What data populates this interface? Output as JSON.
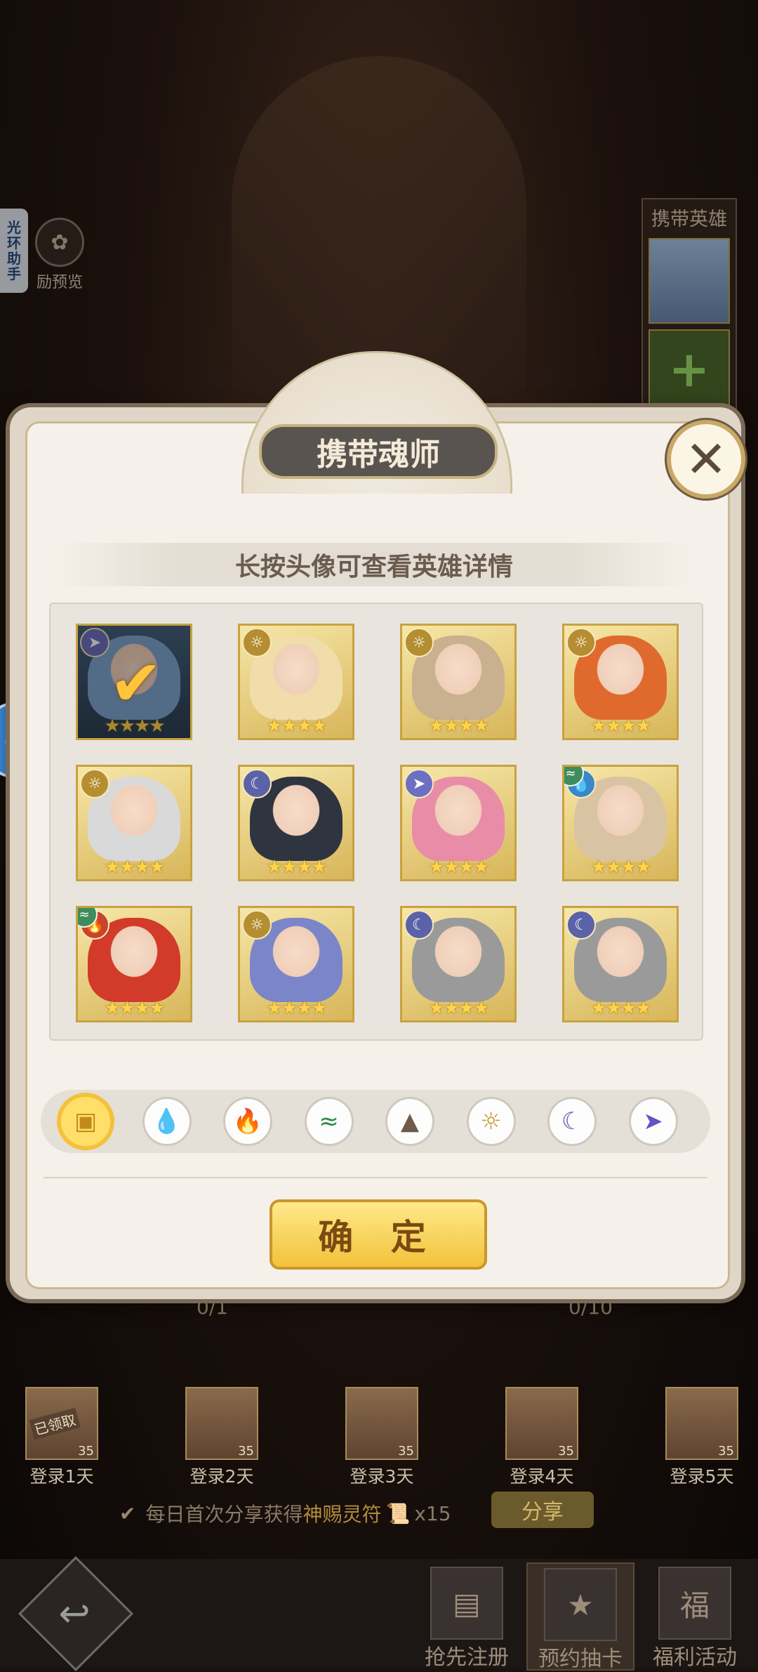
{
  "side": {
    "assist_tab": [
      "光",
      "环",
      "助",
      "手"
    ],
    "reward_preview": "励预览"
  },
  "carry_hero_panel": {
    "title": "携带英雄",
    "add_icon": "plus-icon"
  },
  "modal": {
    "title": "携带魂师",
    "hint": "长按头像可查看英雄详情",
    "confirm": "确 定",
    "close_icon": "close-icon"
  },
  "heroes": [
    {
      "element": "arrow",
      "stars": 4,
      "selected": true,
      "face": "#7fa6cf"
    },
    {
      "element": "sun",
      "stars": 4,
      "selected": false,
      "face": "#f1ddaa"
    },
    {
      "element": "sun",
      "stars": 4,
      "selected": false,
      "face": "#c9b08e"
    },
    {
      "element": "sun",
      "stars": 4,
      "selected": false,
      "face": "#e06a2e"
    },
    {
      "element": "sun",
      "stars": 4,
      "selected": false,
      "face": "#d9d9d9"
    },
    {
      "element": "moon",
      "stars": 4,
      "selected": false,
      "face": "#2e3440"
    },
    {
      "element": "arrow",
      "stars": 4,
      "selected": false,
      "face": "#e98ca7"
    },
    {
      "element": "water",
      "sub_element": "wind",
      "stars": 4,
      "selected": false,
      "face": "#d8c4a2"
    },
    {
      "element": "fire",
      "sub_element": "wind",
      "stars": 4,
      "selected": false,
      "face": "#d23a2a"
    },
    {
      "element": "sun",
      "stars": 4,
      "selected": false,
      "face": "#7b86c9"
    },
    {
      "element": "moon",
      "stars": 4,
      "selected": false,
      "face": "#9a9a9a"
    },
    {
      "element": "moon",
      "stars": 4,
      "selected": false,
      "face": "#9a9a9a"
    }
  ],
  "filters": [
    {
      "name": "all",
      "icon": "box-icon",
      "active": true
    },
    {
      "name": "water",
      "icon": "water-icon",
      "active": false
    },
    {
      "name": "fire",
      "icon": "fire-icon",
      "active": false
    },
    {
      "name": "wind",
      "icon": "wind-icon",
      "active": false
    },
    {
      "name": "earth",
      "icon": "mountain-icon",
      "active": false
    },
    {
      "name": "light",
      "icon": "sun-icon",
      "active": false
    },
    {
      "name": "dark",
      "icon": "moon-icon",
      "active": false
    },
    {
      "name": "arrow",
      "icon": "arrow-icon",
      "active": false
    }
  ],
  "progress": {
    "left": "0/1",
    "right": "0/10"
  },
  "login_rewards": [
    {
      "label": "登录1天",
      "qty": "35",
      "claimed_text": "已领取"
    },
    {
      "label": "登录2天",
      "qty": "35"
    },
    {
      "label": "登录3天",
      "qty": "35"
    },
    {
      "label": "登录4天",
      "qty": "35"
    },
    {
      "label": "登录5天",
      "qty": "35"
    }
  ],
  "share": {
    "text": "每日首次分享获得",
    "item": "神赐灵符",
    "count": "x15",
    "button": "分享"
  },
  "nav": {
    "tabs": [
      {
        "label": "抢先注册",
        "icon": "cards-icon"
      },
      {
        "label": "预约抽卡",
        "icon": "star-card-icon",
        "active": true
      },
      {
        "label": "福利活动",
        "icon": "fortune-icon"
      }
    ]
  },
  "colors": {
    "accent_gold": "#f2c23a",
    "frame": "#cbb98e",
    "star": "#ffd34a"
  }
}
